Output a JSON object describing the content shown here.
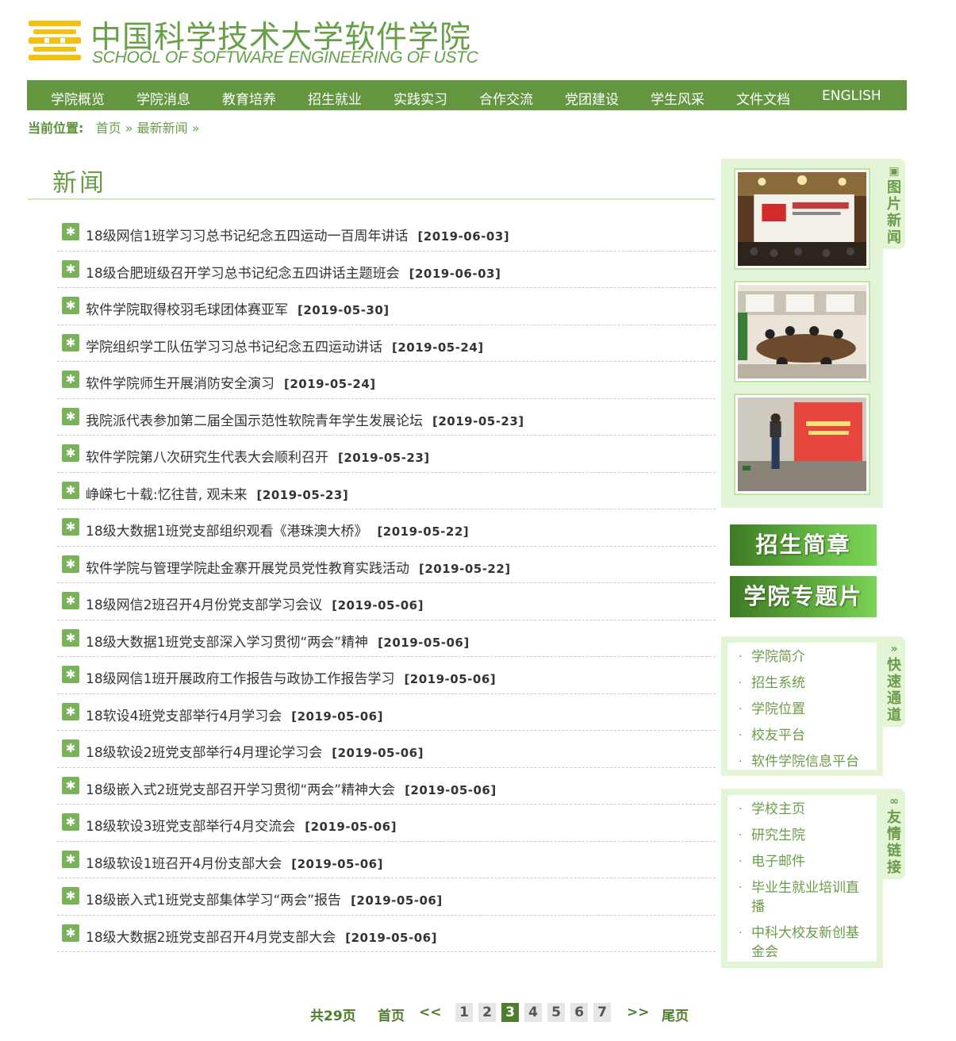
{
  "header": {
    "title_cn": "中国科学技术大学软件学院",
    "title_en": "SCHOOL OF SOFTWARE ENGINEERING OF USTC",
    "brand_color": "#64963f",
    "logo_color": "#f2c114"
  },
  "nav": {
    "items": [
      "学院概览",
      "学院消息",
      "教育培养",
      "招生就业",
      "实践实习",
      "合作交流",
      "党团建设",
      "学生风采",
      "文件文档",
      "ENGLISH"
    ]
  },
  "breadcrumb": {
    "label": "当前位置:",
    "home": "首页",
    "sep": "»",
    "current": "最新新闻",
    "trail": "»"
  },
  "main": {
    "title": "新闻",
    "news": [
      {
        "title": "18级网信1班学习习总书记纪念五四运动一百周年讲话",
        "date": "[2019-06-03]"
      },
      {
        "title": "18级合肥班级召开学习总书记纪念五四讲话主题班会",
        "date": "[2019-06-03]"
      },
      {
        "title": "软件学院取得校羽毛球团体赛亚军",
        "date": "[2019-05-30]"
      },
      {
        "title": "学院组织学工队伍学习习总书记纪念五四运动讲话",
        "date": "[2019-05-24]"
      },
      {
        "title": "软件学院师生开展消防安全演习",
        "date": "[2019-05-24]"
      },
      {
        "title": "我院派代表参加第二届全国示范性软院青年学生发展论坛",
        "date": "[2019-05-23]"
      },
      {
        "title": "软件学院第八次研究生代表大会顺利召开",
        "date": "[2019-05-23]"
      },
      {
        "title": "峥嵘七十载:忆往昔, 观未来",
        "date": "[2019-05-23]"
      },
      {
        "title": "18级大数据1班党支部组织观看《港珠澳大桥》",
        "date": "[2019-05-22]"
      },
      {
        "title": "软件学院与管理学院赴金寨开展党员党性教育实践活动",
        "date": "[2019-05-22]"
      },
      {
        "title": "18级网信2班召开4月份党支部学习会议",
        "date": "[2019-05-06]"
      },
      {
        "title": "18级大数据1班党支部深入学习贯彻“两会”精神",
        "date": "[2019-05-06]"
      },
      {
        "title": "18级网信1班开展政府工作报告与政协工作报告学习",
        "date": "[2019-05-06]"
      },
      {
        "title": "18软设4班党支部举行4月学习会",
        "date": "[2019-05-06]"
      },
      {
        "title": "18级软设2班党支部举行4月理论学习会",
        "date": "[2019-05-06]"
      },
      {
        "title": "18级嵌入式2班党支部召开学习贯彻“两会”精神大会",
        "date": "[2019-05-06]"
      },
      {
        "title": "18级软设3班党支部举行4月交流会",
        "date": "[2019-05-06]"
      },
      {
        "title": "18级软设1班召开4月份支部大会",
        "date": "[2019-05-06]"
      },
      {
        "title": "18级嵌入式1班党支部集体学习“两会”报告",
        "date": "[2019-05-06]"
      },
      {
        "title": "18级大数据2班党支部召开4月党支部大会",
        "date": "[2019-05-06]"
      }
    ]
  },
  "pager": {
    "total": "共29页",
    "first": "首页",
    "prev": "<<",
    "pages": [
      "1",
      "2",
      "3",
      "4",
      "5",
      "6",
      "7"
    ],
    "current": "3",
    "next": ">>",
    "last": "尾页"
  },
  "sidebar": {
    "photo_tab": "图片新闻",
    "photo_tab_icon": "picture-icon",
    "banners": [
      "招生简章",
      "学院专题片"
    ],
    "quick_tab": "快速通道",
    "quick_tab_icon": "double-chevron-icon",
    "quick_links": [
      "学院简介",
      "招生系统",
      "学院位置",
      "校友平台",
      "软件学院信息平台"
    ],
    "friend_tab": "友情链接",
    "friend_tab_icon": "link-icon",
    "friend_links": [
      "学校主页",
      "研究生院",
      "电子邮件",
      "毕业生就业培训直播",
      "中科大校友新创基金会"
    ],
    "bullet": "·"
  }
}
